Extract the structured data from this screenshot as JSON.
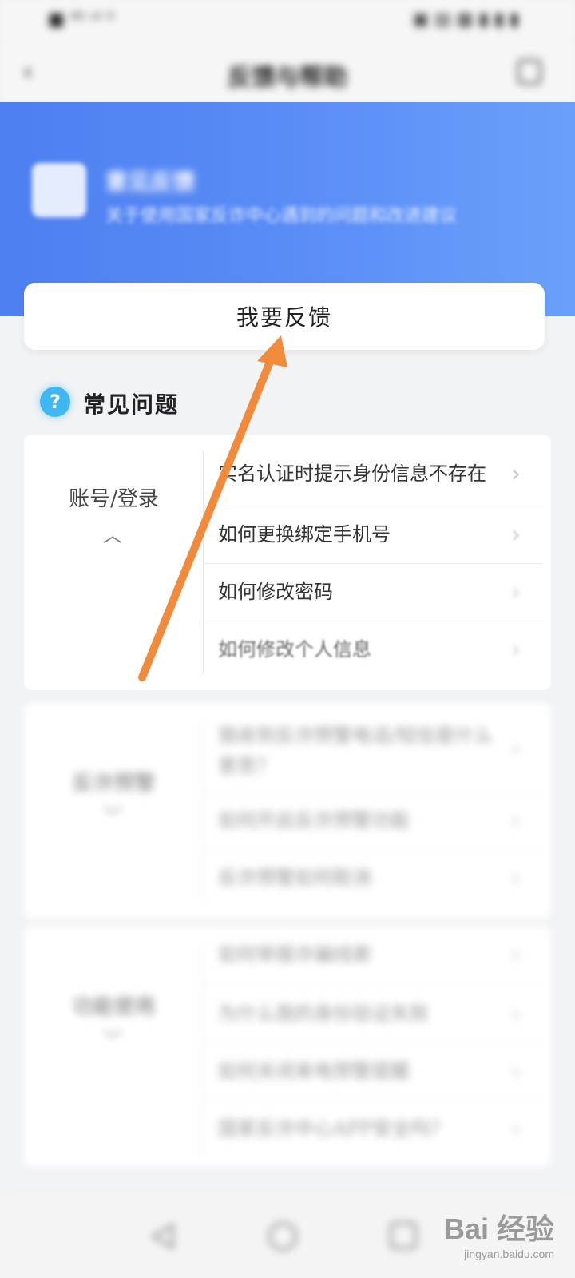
{
  "status_bar": {
    "left": "■ ⁴ᴳ  ᵃᴵ  ⁰",
    "right": "▣ ▤ ▦ ▮ ▮ ▮"
  },
  "header": {
    "title": "反馈与帮助"
  },
  "banner": {
    "title": "意见反馈",
    "subtitle": "关于使用国家反诈中心遇到的问题和改进建议"
  },
  "feedback_button": {
    "label": "我要反馈"
  },
  "faq": {
    "title": "常见问题"
  },
  "categories": [
    {
      "name": "账号/登录",
      "questions": [
        "实名认证时提示身份信息不存在",
        "如何更换绑定手机号",
        "如何修改密码",
        "如何修改个人信息"
      ]
    },
    {
      "name": "反诈预警",
      "questions": [
        "我收到反诈预警电话/短信是什么意思？",
        "如何开启反诈预警功能",
        "反诈预警如何取消"
      ]
    },
    {
      "name": "功能使用",
      "questions": [
        "如何举报诈骗线索",
        "为什么我的身份验证失败",
        "如何关闭来电预警提醒",
        "国家反诈中心APP安全吗？"
      ]
    }
  ],
  "watermark": {
    "logo": "Bai 经验",
    "url": "jingyan.baidu.com"
  },
  "colors": {
    "banner_start": "#4d7ff0",
    "banner_end": "#6aa0fb",
    "faq_icon": "#3fb7f3",
    "arrow": "#f28a3b"
  }
}
